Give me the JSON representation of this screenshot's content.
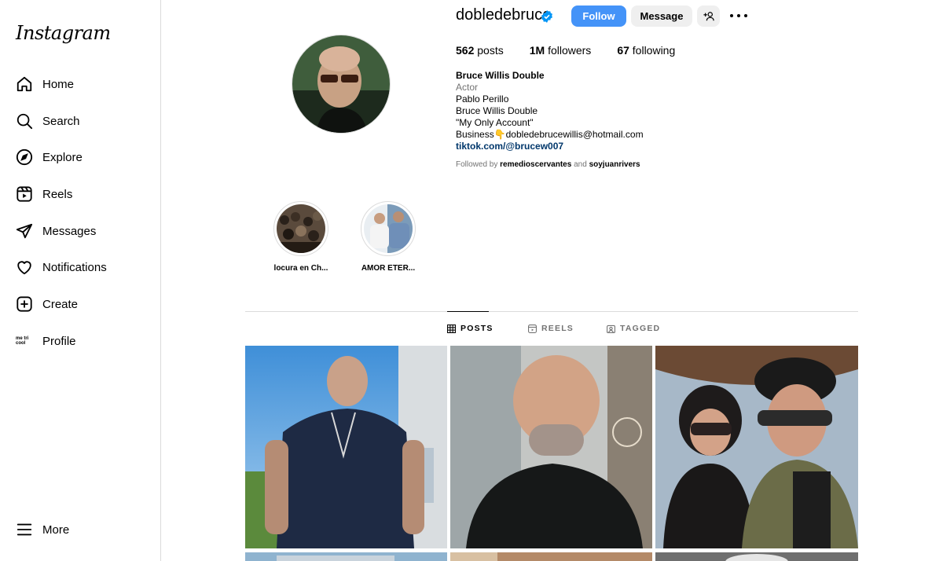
{
  "sidebar": {
    "logo": "Instagram",
    "items": [
      {
        "label": "Home",
        "icon": "home-icon"
      },
      {
        "label": "Search",
        "icon": "search-icon"
      },
      {
        "label": "Explore",
        "icon": "compass-icon"
      },
      {
        "label": "Reels",
        "icon": "reels-icon"
      },
      {
        "label": "Messages",
        "icon": "paper-plane-icon"
      },
      {
        "label": "Notifications",
        "icon": "heart-icon"
      },
      {
        "label": "Create",
        "icon": "plus-square-icon"
      },
      {
        "label": "Profile",
        "icon": "profile-avatar-icon"
      }
    ],
    "more_label": "More",
    "profile_icon_text": "me tri cool"
  },
  "profile": {
    "username": "dobledebruce",
    "follow_label": "Follow",
    "message_label": "Message",
    "stats": {
      "posts_count": "562",
      "posts_label": "posts",
      "followers_count": "1M",
      "followers_label": "followers",
      "following_count": "67",
      "following_label": "following"
    },
    "bio": {
      "name": "Bruce Willis Double",
      "category": "Actor",
      "line1": "Pablo Perillo",
      "line2": "Bruce Willis Double",
      "line3": "\"My Only Account\"",
      "line4": "Business👇dobledebrucewillis@hotmail.com",
      "link": "tiktok.com/@brucew007"
    },
    "followed_by": {
      "prefix": "Followed by",
      "user1": "remedioscervantes",
      "and": "and",
      "user2": "soyjuanrivers"
    }
  },
  "highlights": [
    {
      "caption": "locura en Ch..."
    },
    {
      "caption": "AMOR ETER..."
    }
  ],
  "tabs": [
    {
      "label": "POSTS",
      "active": true
    },
    {
      "label": "REELS",
      "active": false
    },
    {
      "label": "TAGGED",
      "active": false
    }
  ],
  "colors": {
    "accent": "#4493f8",
    "link": "#00376b",
    "muted": "#737373",
    "border": "#dbdbdb"
  }
}
